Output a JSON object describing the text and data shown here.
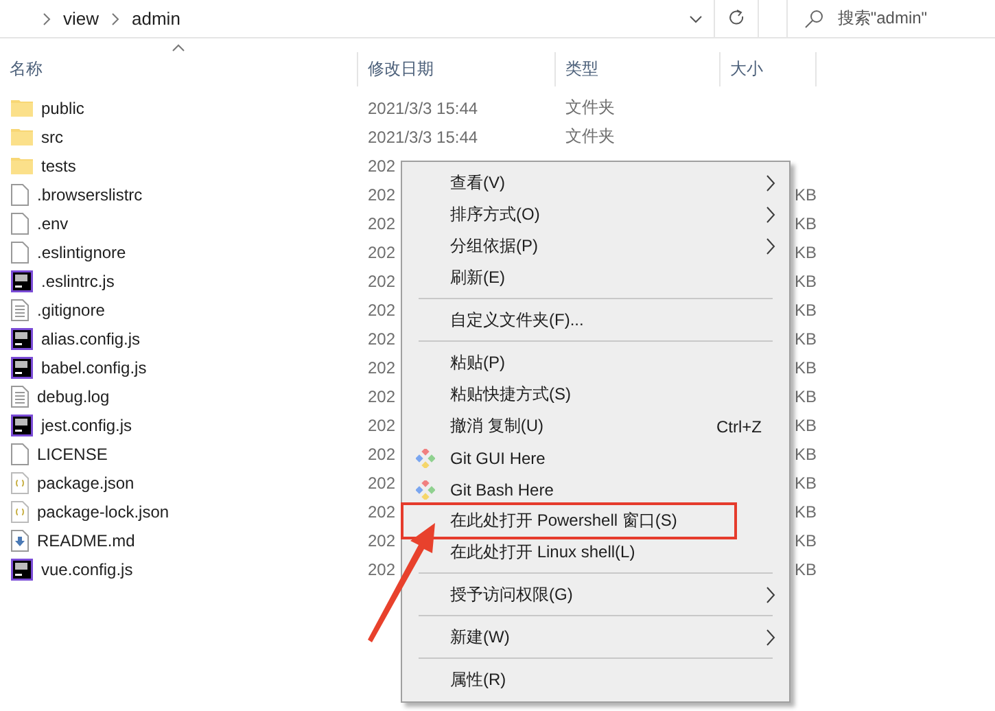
{
  "address_bar": {
    "path": [
      {
        "label": "view"
      },
      {
        "label": "admin"
      }
    ]
  },
  "search": {
    "placeholder": "搜索\"admin\""
  },
  "columns": [
    {
      "label": "名称",
      "sorted": true
    },
    {
      "label": "修改日期"
    },
    {
      "label": "类型"
    },
    {
      "label": "大小"
    }
  ],
  "files": [
    {
      "name": "public",
      "kind": "folder",
      "date": "2021/3/3 15:44",
      "type": "文件夹"
    },
    {
      "name": "src",
      "kind": "folder",
      "date": "2021/3/3 15:44",
      "type": "文件夹"
    },
    {
      "name": "tests",
      "kind": "folder",
      "date": "202"
    },
    {
      "name": ".browserslistrc",
      "kind": "file",
      "date": "202",
      "size": "KB"
    },
    {
      "name": ".env",
      "kind": "file",
      "date": "202",
      "size": "KB"
    },
    {
      "name": ".eslintignore",
      "kind": "file",
      "date": "202",
      "size": "KB"
    },
    {
      "name": ".eslintrc.js",
      "kind": "ps",
      "date": "202",
      "size": "KB"
    },
    {
      "name": ".gitignore",
      "kind": "text",
      "date": "202",
      "size": "KB"
    },
    {
      "name": "alias.config.js",
      "kind": "ps",
      "date": "202",
      "size": "KB"
    },
    {
      "name": "babel.config.js",
      "kind": "ps",
      "date": "202",
      "size": "KB"
    },
    {
      "name": "debug.log",
      "kind": "text",
      "date": "202",
      "size": "KB"
    },
    {
      "name": "jest.config.js",
      "kind": "ps",
      "date": "202",
      "size": "KB"
    },
    {
      "name": "LICENSE",
      "kind": "file",
      "date": "202",
      "size": "KB"
    },
    {
      "name": "package.json",
      "kind": "json",
      "date": "202",
      "size": "KB"
    },
    {
      "name": "package-lock.json",
      "kind": "json",
      "date": "202",
      "size": "KB"
    },
    {
      "name": "README.md",
      "kind": "md",
      "date": "202",
      "size": "KB"
    },
    {
      "name": "vue.config.js",
      "kind": "ps",
      "date": "202",
      "size": "KB"
    }
  ],
  "context_menu": [
    {
      "kind": "item",
      "label": "查看(V)",
      "submenu": true
    },
    {
      "kind": "item",
      "label": "排序方式(O)",
      "submenu": true
    },
    {
      "kind": "item",
      "label": "分组依据(P)",
      "submenu": true
    },
    {
      "kind": "item",
      "label": "刷新(E)"
    },
    {
      "kind": "separator"
    },
    {
      "kind": "item",
      "label": "自定义文件夹(F)..."
    },
    {
      "kind": "separator"
    },
    {
      "kind": "item",
      "label": "粘贴(P)"
    },
    {
      "kind": "item",
      "label": "粘贴快捷方式(S)"
    },
    {
      "kind": "item",
      "label": "撤消 复制(U)",
      "shortcut": "Ctrl+Z"
    },
    {
      "kind": "git",
      "label": "Git GUI Here"
    },
    {
      "kind": "git",
      "label": "Git Bash Here"
    },
    {
      "kind": "item",
      "label": "在此处打开 Powershell 窗口(S)",
      "highlighted": true
    },
    {
      "kind": "item",
      "label": "在此处打开 Linux shell(L)"
    },
    {
      "kind": "separator"
    },
    {
      "kind": "item",
      "label": "授予访问权限(G)",
      "submenu": true
    },
    {
      "kind": "separator"
    },
    {
      "kind": "item",
      "label": "新建(W)",
      "submenu": true
    },
    {
      "kind": "separator"
    },
    {
      "kind": "item",
      "label": "属性(R)"
    }
  ]
}
